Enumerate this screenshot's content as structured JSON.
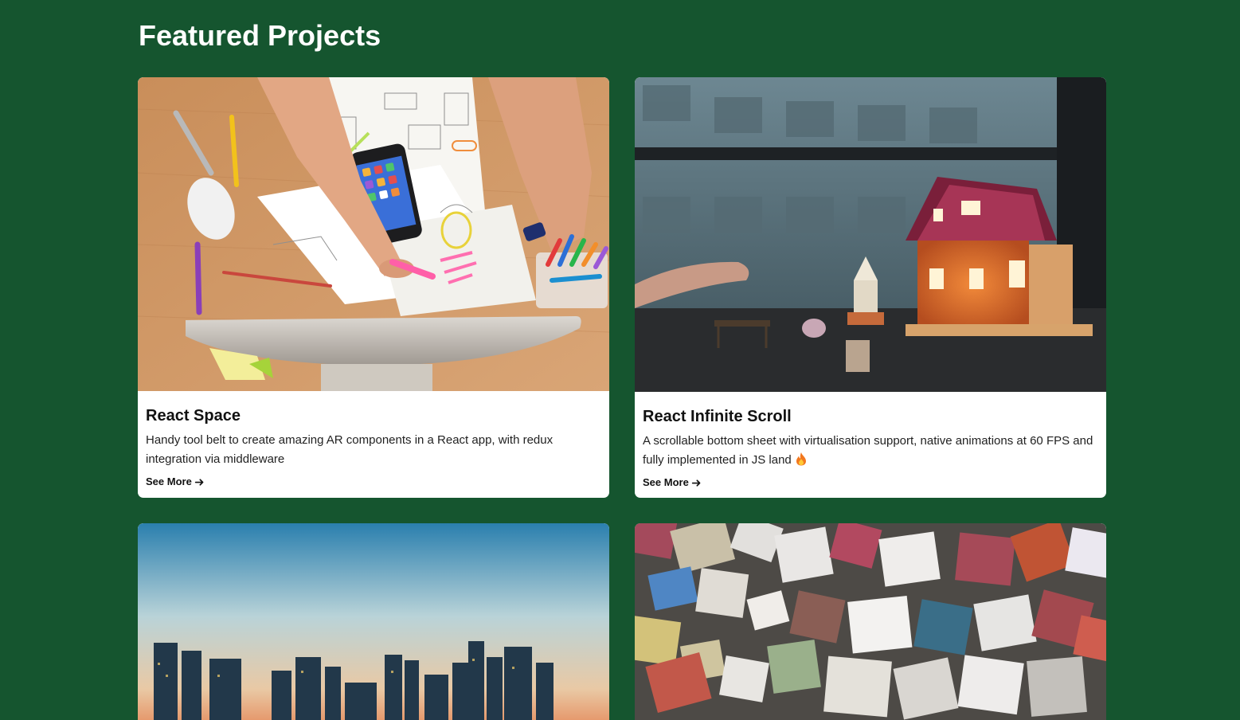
{
  "section": {
    "title": "Featured Projects"
  },
  "projects": [
    {
      "title": "React Space",
      "description": "Handy tool belt to create amazing AR components in a React app, with redux integration via middleware",
      "link_label": "See More",
      "image_icon": "workspace-desk-photo"
    },
    {
      "title": "React Infinite Scroll",
      "description": "A scrollable bottom sheet with virtualisation support, native animations at 60 FPS and fully implemented in JS land",
      "description_emoji": "fire-icon",
      "link_label": "See More",
      "image_icon": "dollhouse-photo"
    },
    {
      "image_icon": "city-skyline-photo"
    },
    {
      "image_icon": "colored-bricks-photo"
    }
  ],
  "colors": {
    "background": "#15552f",
    "card": "#ffffff",
    "heading": "#ffffff",
    "text": "#111111"
  }
}
